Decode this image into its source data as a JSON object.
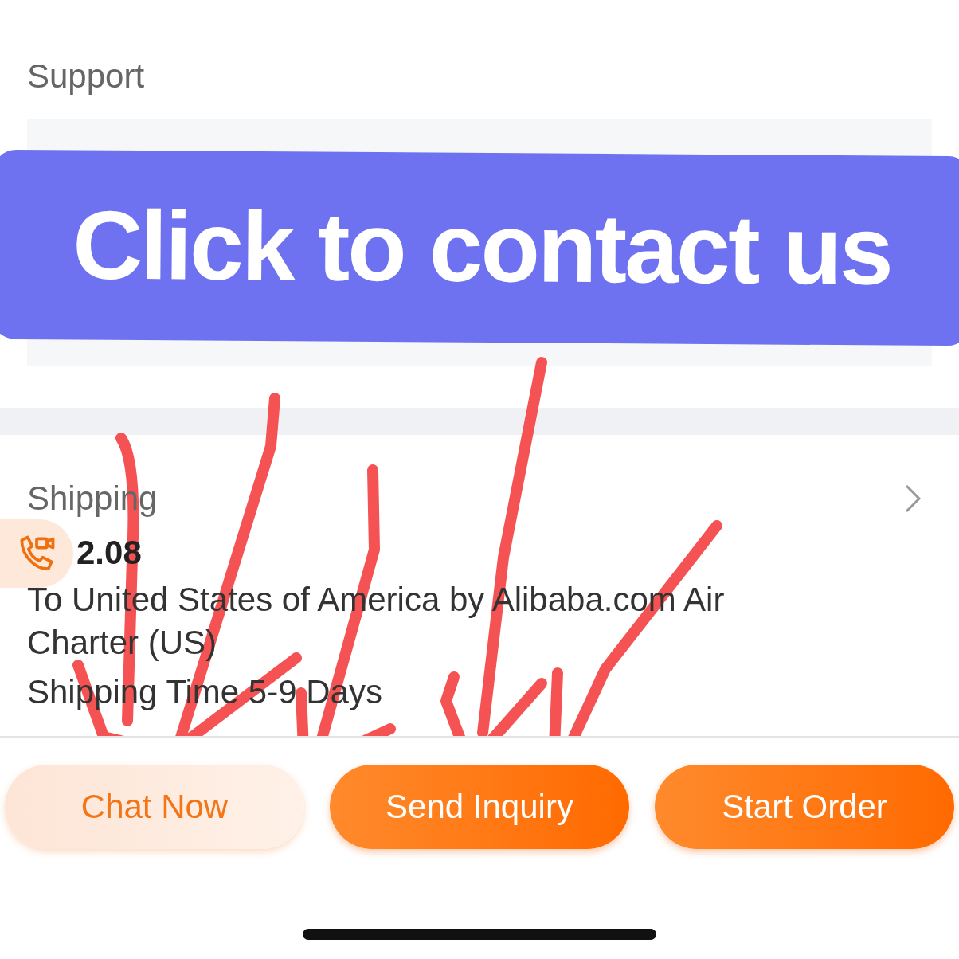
{
  "support": {
    "title": "Support"
  },
  "banner": {
    "text": "Click to contact us"
  },
  "shipping": {
    "title": "Shipping",
    "price": "2.08",
    "route": "To United States of America by Alibaba.com Air Charter (US)",
    "time": "Shipping Time 5-9 Days"
  },
  "buttons": [
    {
      "label": "Chat Now",
      "kind": "secondary"
    },
    {
      "label": "Send Inquiry",
      "kind": "primary"
    },
    {
      "label": "Start Order",
      "kind": "primary"
    }
  ]
}
